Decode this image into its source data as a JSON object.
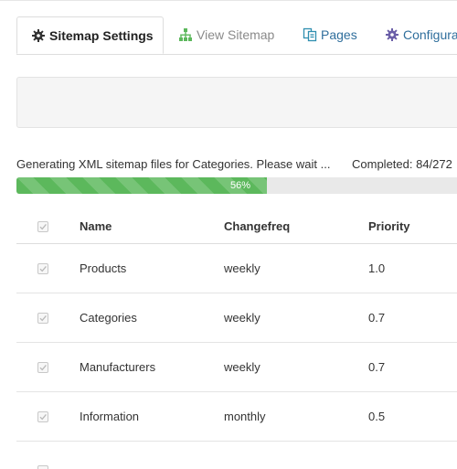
{
  "tabs": [
    {
      "label": "Sitemap Settings",
      "icon": "gear-icon"
    },
    {
      "label": "View Sitemap",
      "icon": "sitemap-icon"
    },
    {
      "label": "Pages",
      "icon": "pages-icon"
    },
    {
      "label": "Configura",
      "icon": "gear-icon"
    }
  ],
  "status": {
    "message": "Generating XML sitemap files for Categories. Please wait ...",
    "completed": "Completed: 84/272"
  },
  "progress": {
    "percent": 56,
    "label": "56%",
    "color": "#5cb85c"
  },
  "table": {
    "headers": {
      "name": "Name",
      "changefreq": "Changefreq",
      "priority": "Priority"
    },
    "rows": [
      {
        "name": "Products",
        "changefreq": "weekly",
        "priority": "1.0",
        "checked": true
      },
      {
        "name": "Categories",
        "changefreq": "weekly",
        "priority": "0.7",
        "checked": true
      },
      {
        "name": "Manufacturers",
        "changefreq": "weekly",
        "priority": "0.7",
        "checked": true
      },
      {
        "name": "Information",
        "changefreq": "monthly",
        "priority": "0.5",
        "checked": true
      }
    ]
  }
}
